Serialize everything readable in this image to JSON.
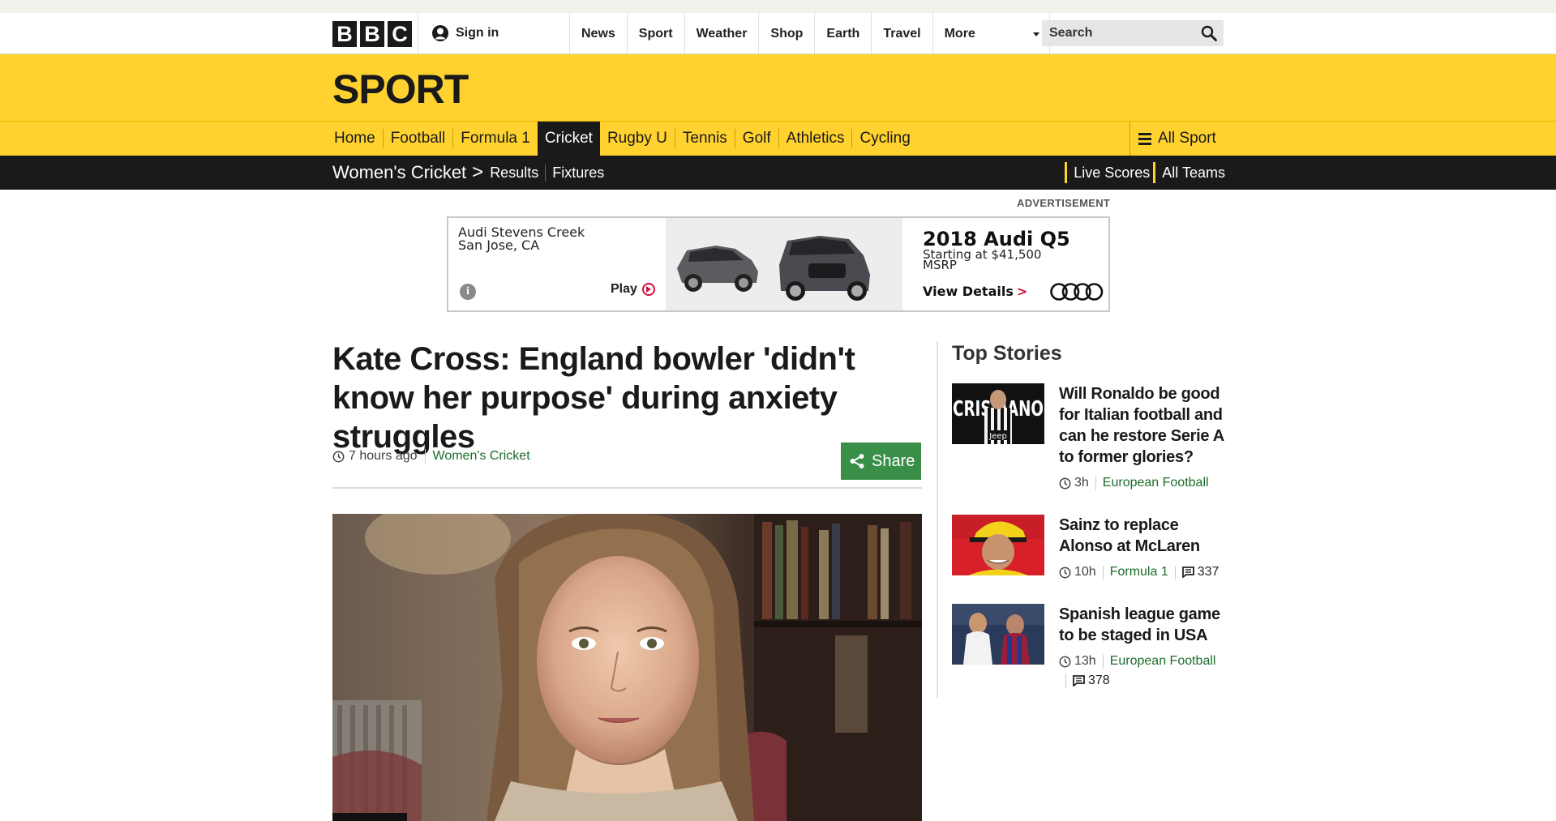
{
  "global_nav": {
    "logo_letters": [
      "B",
      "B",
      "C"
    ],
    "signin_label": "Sign in",
    "links": [
      "News",
      "Sport",
      "Weather",
      "Shop",
      "Earth",
      "Travel",
      "More"
    ],
    "search_placeholder": "Search"
  },
  "sport_header": {
    "title": "SPORT"
  },
  "sport_nav": {
    "items": [
      "Home",
      "Football",
      "Formula 1",
      "Cricket",
      "Rugby U",
      "Tennis",
      "Golf",
      "Athletics",
      "Cycling"
    ],
    "active": "Cricket",
    "all_sport_label": "All Sport"
  },
  "sub_nav": {
    "section": "Women's Cricket",
    "separator": ">",
    "links": [
      "Results",
      "Fixtures"
    ],
    "right_links": [
      "Live Scores",
      "All Teams"
    ]
  },
  "advertisement": {
    "label": "ADVERTISEMENT",
    "dealer_line1": "Audi Stevens Creek",
    "dealer_line2": "San Jose, CA",
    "play_label": "Play",
    "headline": "2018 Audi Q5",
    "price_line": "Starting at $41,500",
    "msrp": "MSRP",
    "cta": "View Details",
    "cta_arrow": ">",
    "info_glyph": "i"
  },
  "article": {
    "headline": "Kate Cross: England bowler 'didn't know her purpose' during anxiety struggles",
    "time": "7 hours ago",
    "section": "Women's Cricket",
    "share_label": "Share"
  },
  "top_stories": {
    "heading": "Top Stories",
    "stories": [
      {
        "title": "Will Ronaldo be good for Italian football and can he restore Serie A to former glories?",
        "time": "3h",
        "section": "European Football",
        "comments": ""
      },
      {
        "title": "Sainz to replace Alonso at McLaren",
        "time": "10h",
        "section": "Formula 1",
        "comments": "337"
      },
      {
        "title": "Spanish league game to be staged in USA",
        "time": "13h",
        "section": "European Football",
        "comments": "378"
      }
    ],
    "thumb1_text": "CRISTIANO",
    "thumb1_sponsor": "Jeep"
  },
  "colors": {
    "sport_yellow": "#ffd230",
    "nav_black": "#1a1a1a",
    "share_green": "#398f47",
    "section_green": "#1d6c2b",
    "ad_red": "#d0103a"
  },
  "icons": [
    "person-icon",
    "search-icon",
    "hamburger-icon",
    "info-icon",
    "play-icon",
    "audi-rings-logo",
    "clock-icon",
    "share-icon",
    "comment-icon"
  ]
}
